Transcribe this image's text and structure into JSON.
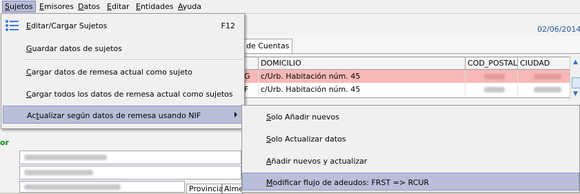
{
  "menubar": {
    "items": [
      {
        "pre": "",
        "key": "S",
        "post": "ujetos"
      },
      {
        "pre": "",
        "key": "E",
        "post": "misores"
      },
      {
        "pre": "",
        "key": "D",
        "post": "atos"
      },
      {
        "pre": "",
        "key": "E",
        "post": "ditar"
      },
      {
        "pre": "",
        "key": "E",
        "post": "ntidades"
      },
      {
        "pre": "",
        "key": "A",
        "post": "yuda"
      }
    ]
  },
  "header": {
    "date": "02/06/2014"
  },
  "tabs": {
    "active_label": "de Cuentas"
  },
  "grid": {
    "columns": [
      "DOMICILIO",
      "COD_POSTAL",
      "CIUDAD"
    ],
    "rows": [
      {
        "lead": "G",
        "domicilio": "c/Urb. Habitación núm. 45"
      },
      {
        "lead": "F",
        "domicilio": "c/Urb. Habitación núm. 45"
      }
    ]
  },
  "lower": {
    "label_partial": "or",
    "provincia_tab": "Provincia",
    "alme_tab": "Alme"
  },
  "sujetos_menu": {
    "items": [
      {
        "pre": "",
        "key": "E",
        "post": "ditar/Cargar Sujetos",
        "shortcut": "F12"
      },
      {
        "pre": "",
        "key": "G",
        "post": "uardar datos de sujetos",
        "shortcut": ""
      },
      {
        "pre": "",
        "key": "C",
        "post": "argar datos de remesa actual como sujeto",
        "shortcut": ""
      },
      {
        "pre": "",
        "key": "C",
        "post": "argar todos los datos de remesa actual como sujetos",
        "shortcut": ""
      },
      {
        "pre": "Ac",
        "key": "t",
        "post": "ualizar según datos de remesa usando NIF",
        "shortcut": ""
      }
    ]
  },
  "submenu": {
    "items": [
      {
        "pre": "",
        "key": "S",
        "post": "olo Añadir nuevos"
      },
      {
        "pre": "",
        "key": "S",
        "post": "olo Actualizar datos"
      },
      {
        "pre": "",
        "key": "A",
        "post": "ñadir nuevos y actualizar"
      },
      {
        "pre": "",
        "key": "M",
        "post": "odificar flujo de adeudos: FRST => RCUR"
      }
    ]
  },
  "colors": {
    "highlight": "#b9bfd8",
    "row_pink": "#f7b8b8",
    "date_blue": "#2155a6",
    "label_green": "#0a8a14"
  },
  "icons": {
    "edit_subjects": "list-icon"
  }
}
